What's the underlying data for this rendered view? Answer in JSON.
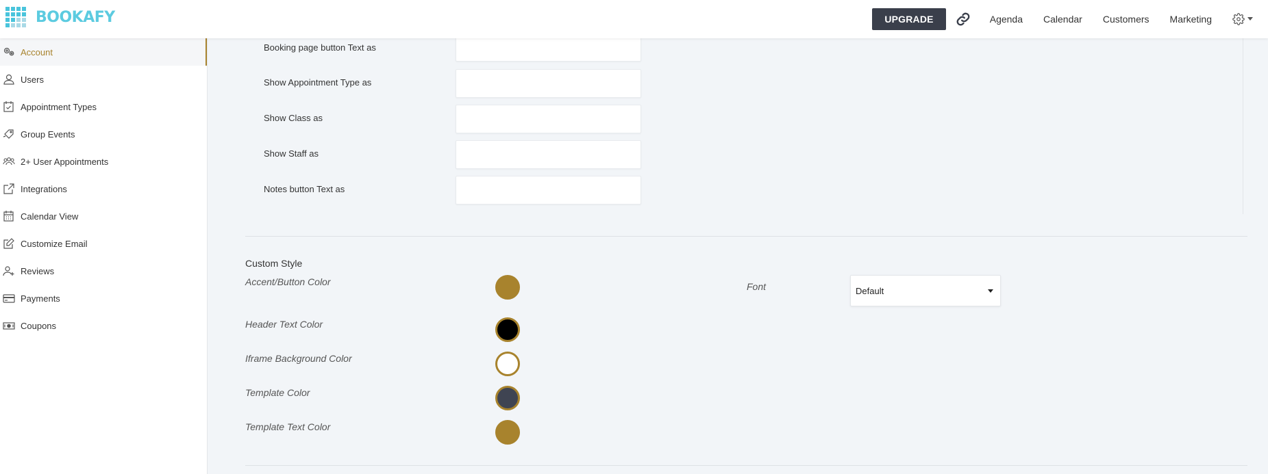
{
  "header": {
    "logo_text": "BOOKAFY",
    "upgrade_label": "UPGRADE",
    "nav": [
      "Agenda",
      "Calendar",
      "Customers",
      "Marketing"
    ]
  },
  "sidebar": {
    "items": [
      {
        "label": "Account",
        "icon": "gears-icon",
        "active": true
      },
      {
        "label": "Users",
        "icon": "user-icon",
        "active": false
      },
      {
        "label": "Appointment Types",
        "icon": "calendar-check-icon",
        "active": false
      },
      {
        "label": "Group Events",
        "icon": "tag-icon",
        "active": false
      },
      {
        "label": "2+ User Appointments",
        "icon": "users-group-icon",
        "active": false
      },
      {
        "label": "Integrations",
        "icon": "external-link-icon",
        "active": false
      },
      {
        "label": "Calendar View",
        "icon": "calendar-icon",
        "active": false
      },
      {
        "label": "Customize Email",
        "icon": "edit-icon",
        "active": false
      },
      {
        "label": "Reviews",
        "icon": "user-plus-icon",
        "active": false
      },
      {
        "label": "Payments",
        "icon": "credit-card-icon",
        "active": false
      },
      {
        "label": "Coupons",
        "icon": "money-icon",
        "active": false
      }
    ]
  },
  "text_fields": [
    {
      "label": "Booking page button Text as",
      "value": ""
    },
    {
      "label": "Show Appointment Type as",
      "value": ""
    },
    {
      "label": "Show Class as",
      "value": ""
    },
    {
      "label": "Show Staff as",
      "value": ""
    },
    {
      "label": "Notes button Text as",
      "value": ""
    }
  ],
  "custom_style": {
    "title": "Custom Style",
    "colors": [
      {
        "label": "Accent/Button Color",
        "value": "#a8832d"
      },
      {
        "label": "Header Text Color",
        "value": "#000000"
      },
      {
        "label": "Iframe Background Color",
        "value": "#ffffff"
      },
      {
        "label": "Template Color",
        "value": "#3f4452"
      },
      {
        "label": "Template Text Color",
        "value": "#a8832d"
      }
    ],
    "font_label": "Font",
    "font_value": "Default"
  },
  "colors": {
    "accent": "#a8832d",
    "upgrade_bg": "#3a3f4b",
    "logo": "#5ccbe0"
  }
}
